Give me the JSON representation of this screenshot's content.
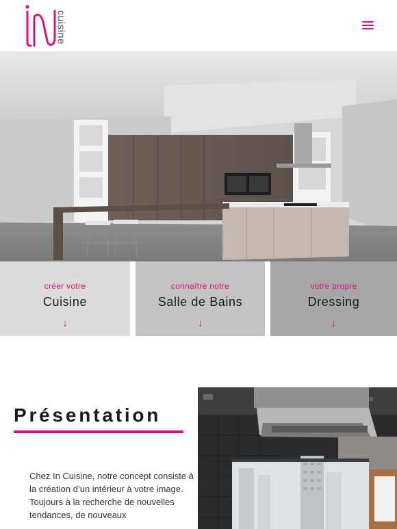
{
  "brand": {
    "logo_mark": "IN",
    "logo_word": "cuisine",
    "accent_color": "#d6107f"
  },
  "header": {
    "menu_icon": "hamburger-icon"
  },
  "hero": {
    "image": "kitchen-interior-photo"
  },
  "tiles": [
    {
      "pre": "créer votre",
      "main": "Cuisine",
      "arrow": "↓"
    },
    {
      "pre": "connaître notre",
      "main": "Salle de Bains",
      "arrow": "↓"
    },
    {
      "pre": "votre propre",
      "main": "Dressing",
      "arrow": "↓"
    }
  ],
  "presentation": {
    "title": "Présentation",
    "text": "Chez In Cuisine, notre concept consiste à la création d’un intérieur à votre image. Toujours à la recherche de nouvelles tendances, de nouveaux",
    "image": "kitchen-hood-photo"
  }
}
